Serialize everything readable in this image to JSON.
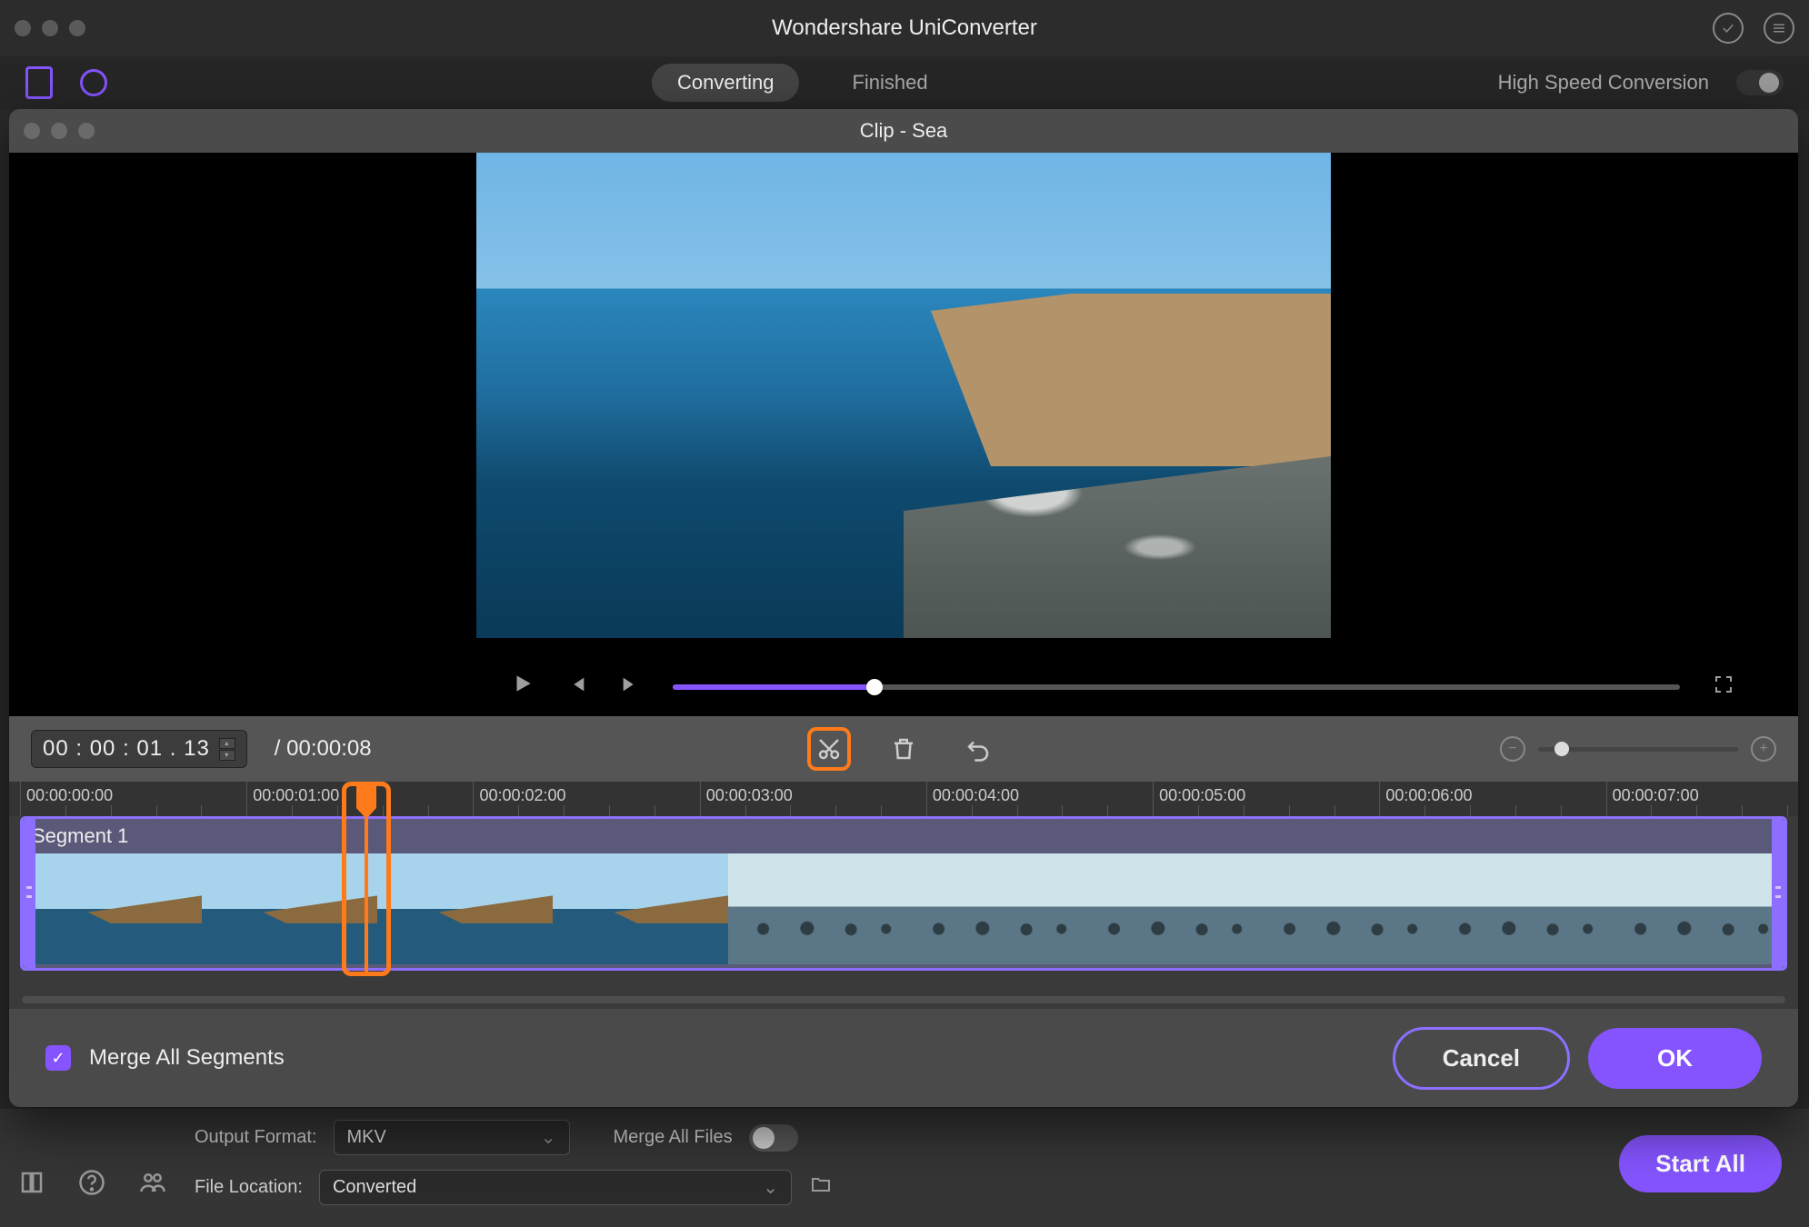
{
  "main": {
    "title": "Wondershare UniConverter",
    "tabs": {
      "converting": "Converting",
      "finished": "Finished"
    },
    "highspeed": "High Speed Conversion",
    "outputFormatLabel": "Output Format:",
    "outputFormatValue": "MKV",
    "mergeAllFiles": "Merge All Files",
    "fileLocationLabel": "File Location:",
    "fileLocationValue": "Converted",
    "startAll": "Start All"
  },
  "clip": {
    "title": "Clip - Sea",
    "currentTime": "00 : 00 : 01 . 13",
    "totalTime": "/ 00:00:08",
    "segmentLabel": "Segment 1",
    "mergeSegments": "Merge All Segments",
    "cancel": "Cancel",
    "ok": "OK",
    "rulerTicks": [
      "00:00:00:00",
      "00:00:01:00",
      "00:00:02:00",
      "00:00:03:00",
      "00:00:04:00",
      "00:00:05:00",
      "00:00:06:00",
      "00:00:07:00"
    ]
  }
}
